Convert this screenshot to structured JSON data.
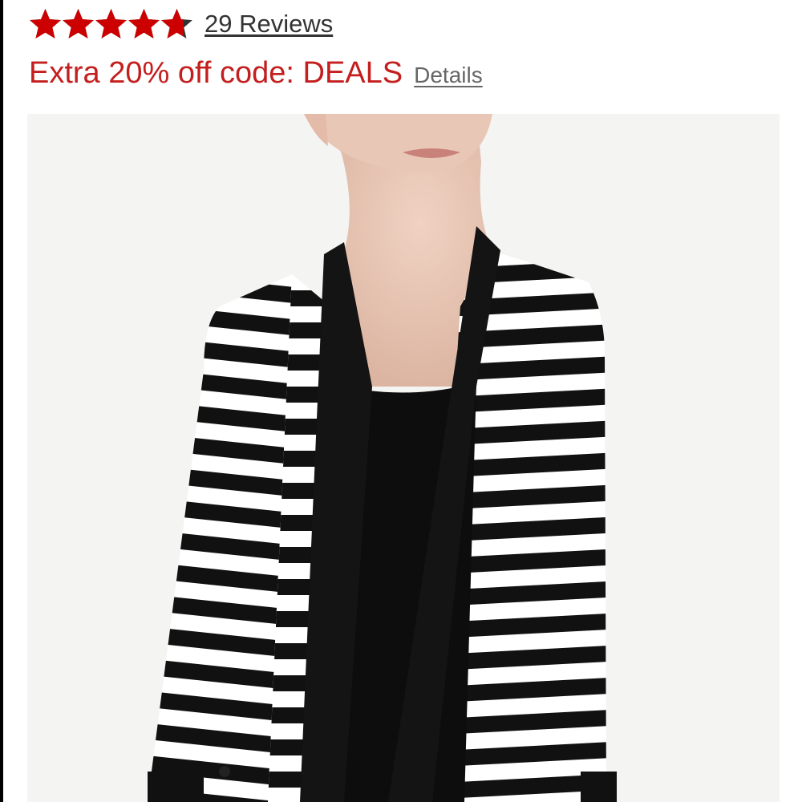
{
  "rating": {
    "stars_filled": 4.7,
    "stars_total": 5,
    "reviews_label": "29 Reviews"
  },
  "promo": {
    "text": "Extra 20% off code: DEALS",
    "details_label": "Details"
  },
  "image": {
    "subject": "striped-cardigan"
  },
  "colors": {
    "star": "#cc0000",
    "star_empty": "#333333",
    "promo": "#c41e1e",
    "link": "#333333"
  }
}
